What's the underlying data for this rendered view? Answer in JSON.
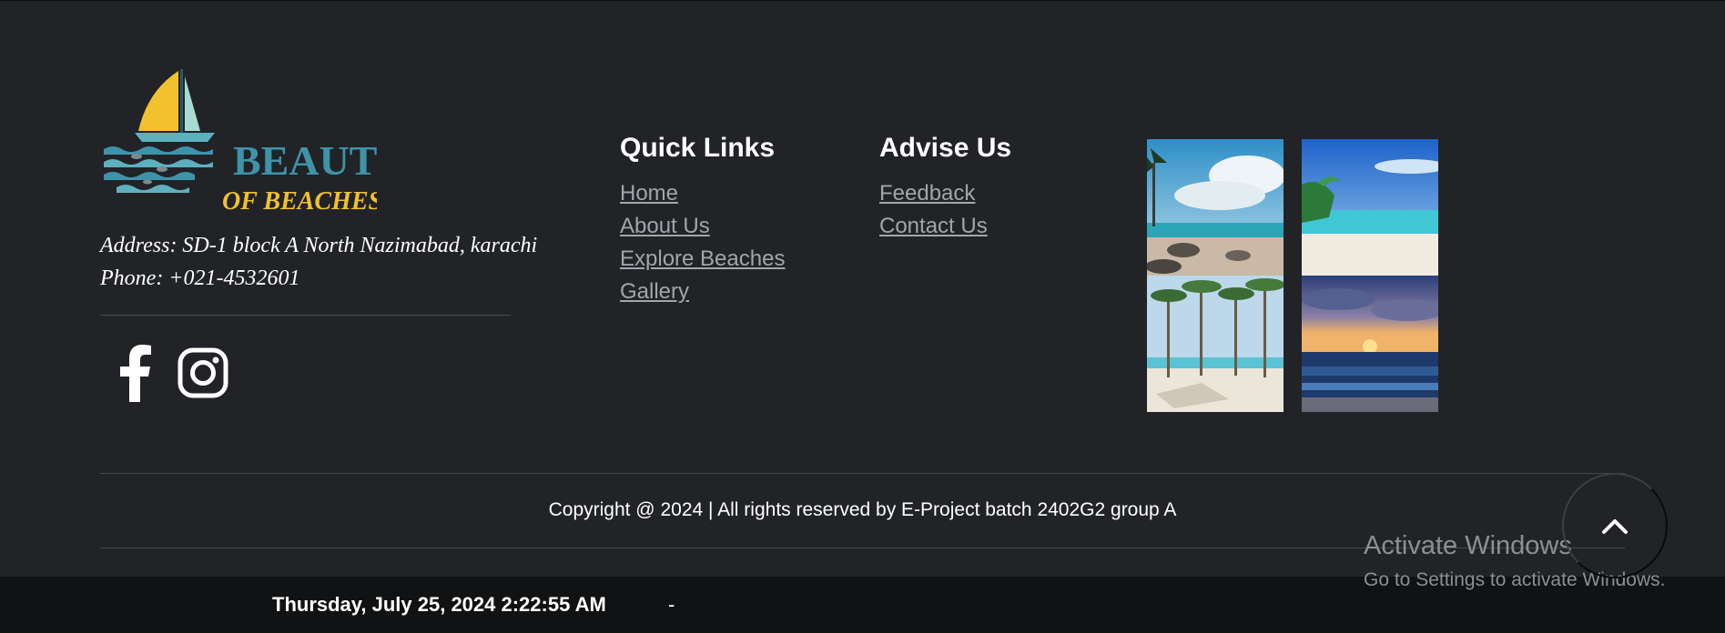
{
  "brand": {
    "logo_word_1": "BEAUTY",
    "logo_word_2": "OF BEACHES",
    "address": "Address: SD-1 block A North Nazimabad, karachi",
    "phone": "Phone: +021-4532601"
  },
  "social": [
    {
      "name": "facebook",
      "icon": "facebook-icon"
    },
    {
      "name": "instagram",
      "icon": "instagram-icon"
    }
  ],
  "quick_links": {
    "title": "Quick Links",
    "items": [
      "Home",
      "About Us",
      "Explore Beaches",
      "Gallery"
    ]
  },
  "advise_us": {
    "title": "Advise Us",
    "items": [
      "Feedback",
      "Contact Us"
    ]
  },
  "gallery": {
    "images": [
      {
        "icon": "beach-rocks-image"
      },
      {
        "icon": "turquoise-beach-image"
      },
      {
        "icon": "palm-trees-image"
      },
      {
        "icon": "sunset-ocean-image"
      }
    ]
  },
  "copyright": "Copyright @ 2024 | All rights reserved by E-Project batch 2402G2 group A",
  "status_bar": {
    "datetime": "Thursday, July 25, 2024 2:22:55 AM",
    "separator": "-"
  },
  "watermark": {
    "title": "Activate Windows",
    "subtitle": "Go to Settings to activate Windows."
  },
  "back_to_top": {
    "icon": "chevron-up-icon"
  },
  "colors": {
    "background": "#212327",
    "bottom_bar": "#111213",
    "link": "#a2a5aa",
    "logo_teal": "#3f93a8",
    "logo_yellow": "#f2c12e"
  }
}
